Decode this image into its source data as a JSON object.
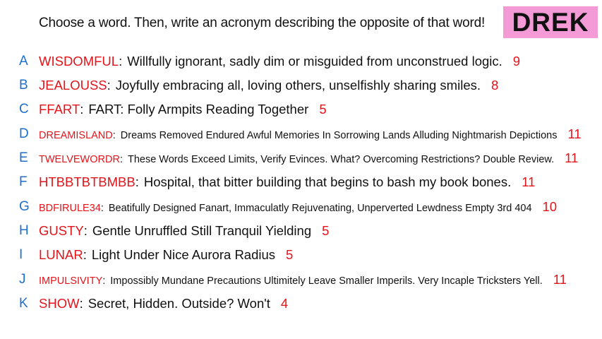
{
  "prompt": "Choose a word. Then, write an acronym describing the opposite of that word!",
  "badge": "DREK",
  "colors": {
    "letter": "#1d6fd0",
    "word": "#e4141b",
    "badge_bg": "#f49ad6",
    "text": "#111111"
  },
  "entries": [
    {
      "letter": "A",
      "word": "WISDOMFUL",
      "definition": "Willfully ignorant, sadly dim or misguided from unconstrued logic.",
      "count": "9"
    },
    {
      "letter": "B",
      "word": "JEALOUSS",
      "definition": "Joyfully embracing all, loving others, unselfishly sharing smiles.",
      "count": "8"
    },
    {
      "letter": "C",
      "word": "FFART",
      "definition": "FART: Folly Armpits Reading Together",
      "count": "5"
    },
    {
      "letter": "D",
      "word": "DREAMISLAND",
      "definition": "Dreams Removed Endured Awful Memories In Sorrowing Lands Alluding Nightmarish Depictions",
      "count": "11"
    },
    {
      "letter": "E",
      "word": "TWELVEWORDR",
      "definition": "These Words Exceed Limits, Verify Evinces. What? Overcoming Restrictions? Double Review.",
      "count": "11"
    },
    {
      "letter": "F",
      "word": "HTBBTBTBMBB",
      "definition": "Hospital, that bitter building that begins to bash my book bones.",
      "count": "11"
    },
    {
      "letter": "G",
      "word": "BDFIRULE34",
      "definition": "Beatifully Designed Fanart, Immaculatly Rejuvenating, Unperverted Lewdness Empty 3rd 404",
      "count": "10"
    },
    {
      "letter": "H",
      "word": "GUSTY",
      "definition": "Gentle Unruffled Still Tranquil Yielding",
      "count": "5"
    },
    {
      "letter": "I",
      "word": "LUNAR",
      "definition": "Light Under Nice Aurora Radius",
      "count": "5"
    },
    {
      "letter": "J",
      "word": "IMPULSIVITY",
      "definition": "Impossibly Mundane Precautions Ultimitely Leave Smaller Imperils. Very Incaple Tricksters Yell.",
      "count": "11"
    },
    {
      "letter": "K",
      "word": "SHOW",
      "definition": "Secret, Hidden. Outside? Won't",
      "count": "4"
    }
  ]
}
